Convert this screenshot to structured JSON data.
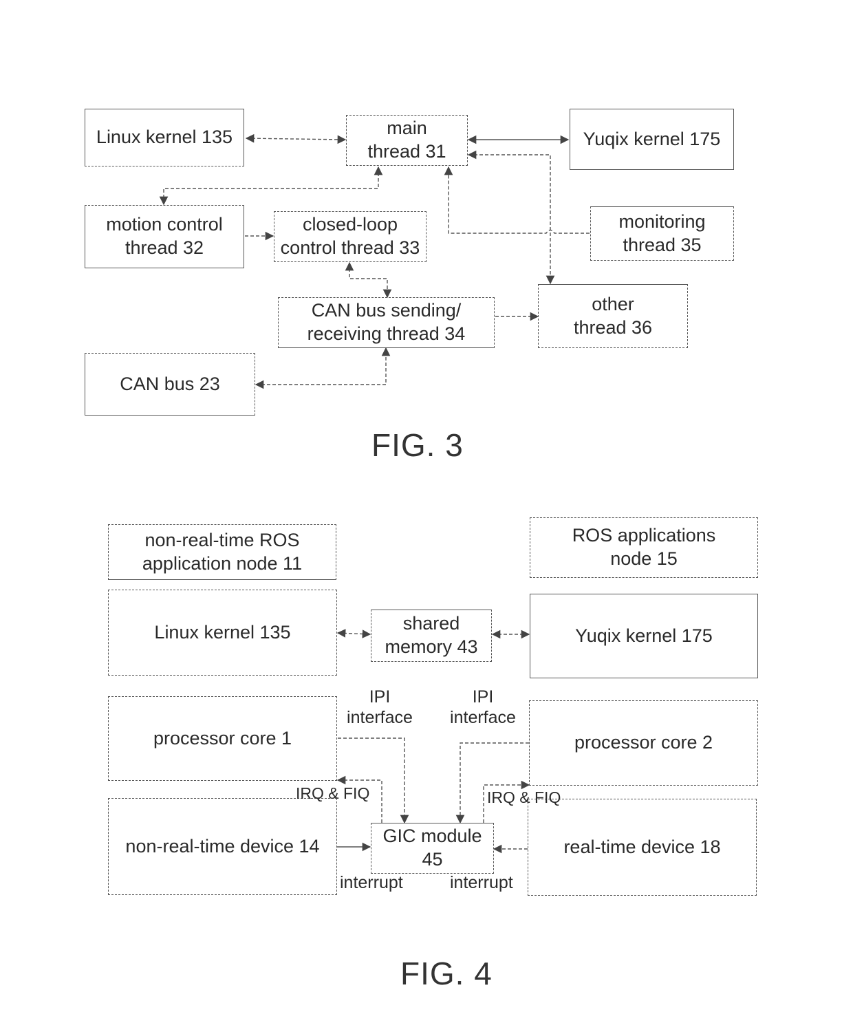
{
  "fig3": {
    "caption": "FIG. 3",
    "nodes": {
      "linux_kernel": [
        "Linux kernel 135"
      ],
      "main_thread": [
        "main",
        "thread 31"
      ],
      "yuqix_kernel": [
        "Yuqix kernel 175"
      ],
      "motion_control": [
        "motion control",
        "thread 32"
      ],
      "closed_loop": [
        "closed-loop",
        "control thread 33"
      ],
      "monitoring": [
        "monitoring",
        "thread 35"
      ],
      "can_thread": [
        "CAN bus sending/",
        "receiving thread 34"
      ],
      "other_thread": [
        "other",
        "thread 36"
      ],
      "can_bus": [
        "CAN bus 23"
      ]
    }
  },
  "fig4": {
    "caption": "FIG. 4",
    "nodes": {
      "ros_node_11": [
        "non-real-time ROS",
        "application node 11"
      ],
      "ros_node_15": [
        "ROS applications",
        "node 15"
      ],
      "linux_kernel": [
        "Linux kernel 135"
      ],
      "shared_memory": [
        "shared",
        "memory 43"
      ],
      "yuqix_kernel": [
        "Yuqix kernel 175"
      ],
      "core1": [
        "processor core 1"
      ],
      "core2": [
        "processor core 2"
      ],
      "nrt_device": [
        "non-real-time device 14"
      ],
      "gic": [
        "GIC module",
        "45"
      ],
      "rt_device": [
        "real-time device 18"
      ]
    },
    "labels": {
      "ipi_left": [
        "IPI",
        "interface"
      ],
      "ipi_right": [
        "IPI",
        "interface"
      ],
      "irq_left": "IRQ & FIQ",
      "irq_right": "IRQ & FIQ",
      "interrupt_left": "interrupt",
      "interrupt_right": "interrupt"
    }
  }
}
